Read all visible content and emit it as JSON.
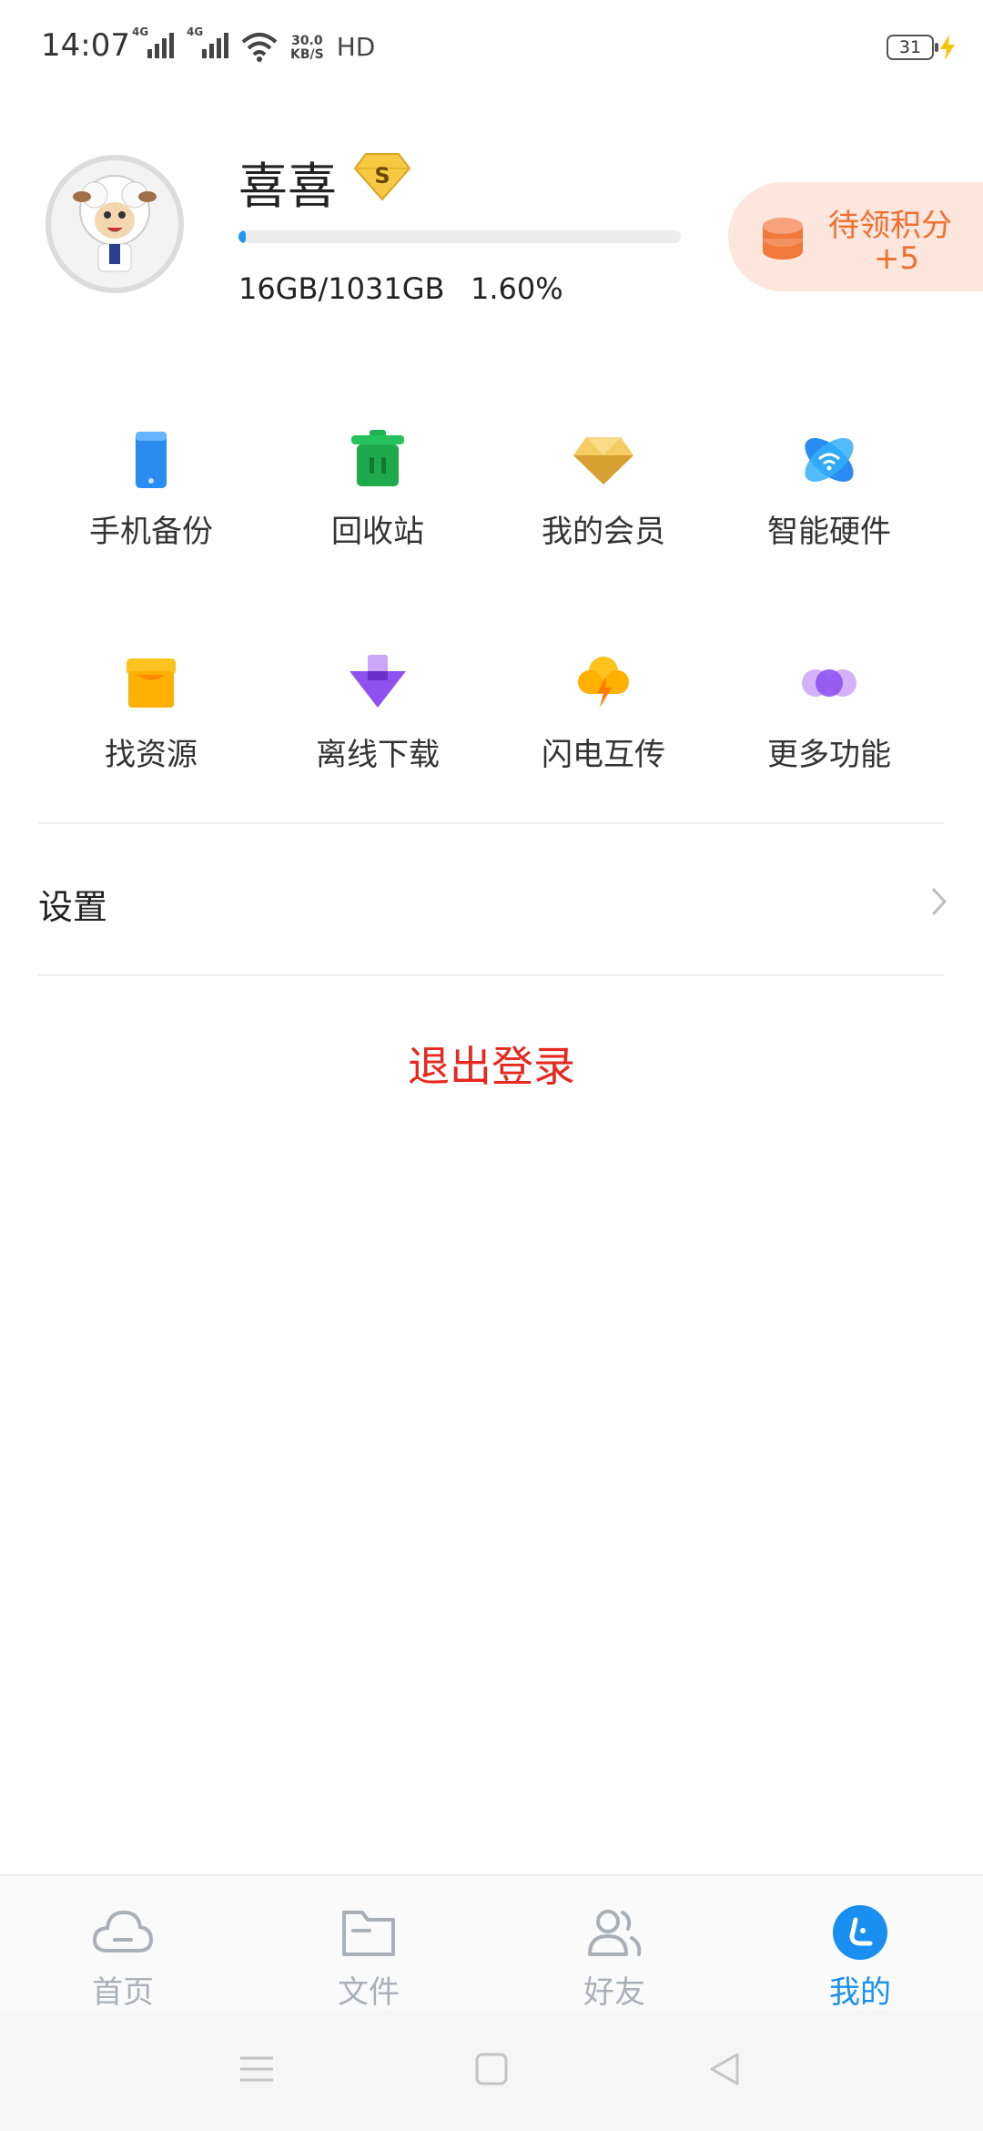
{
  "status_bar": {
    "time": "14:07",
    "network1": "4G",
    "network2": "4G",
    "speed_value": "30.0",
    "speed_unit": "KB/S",
    "hd": "HD",
    "battery": "31"
  },
  "profile": {
    "username": "喜喜",
    "storage_used_text": "16GB/1031GB",
    "storage_percent_text": "1.60%",
    "storage_fraction": 0.016,
    "vip_badge_letter": "S"
  },
  "points": {
    "label": "待领积分",
    "value": "+5"
  },
  "grid": {
    "items": [
      {
        "label": "手机备份",
        "icon": "phone-backup-icon"
      },
      {
        "label": "回收站",
        "icon": "recycle-bin-icon"
      },
      {
        "label": "我的会员",
        "icon": "diamond-icon"
      },
      {
        "label": "智能硬件",
        "icon": "smart-hardware-icon"
      },
      {
        "label": "找资源",
        "icon": "store-icon"
      },
      {
        "label": "离线下载",
        "icon": "offline-download-icon"
      },
      {
        "label": "闪电互传",
        "icon": "lightning-cloud-icon"
      },
      {
        "label": "更多功能",
        "icon": "more-dots-icon"
      }
    ]
  },
  "settings": {
    "label": "设置"
  },
  "logout": {
    "label": "退出登录"
  },
  "bottom_nav": {
    "items": [
      {
        "label": "首页",
        "icon": "cloud-icon"
      },
      {
        "label": "文件",
        "icon": "folder-icon"
      },
      {
        "label": "好友",
        "icon": "friends-icon"
      },
      {
        "label": "我的",
        "icon": "me-icon",
        "active": true
      }
    ]
  },
  "colors": {
    "accent": "#1a8ff2",
    "logout": "#e8281e",
    "points_bg": "#fde6de",
    "points_text": "#f07030"
  }
}
